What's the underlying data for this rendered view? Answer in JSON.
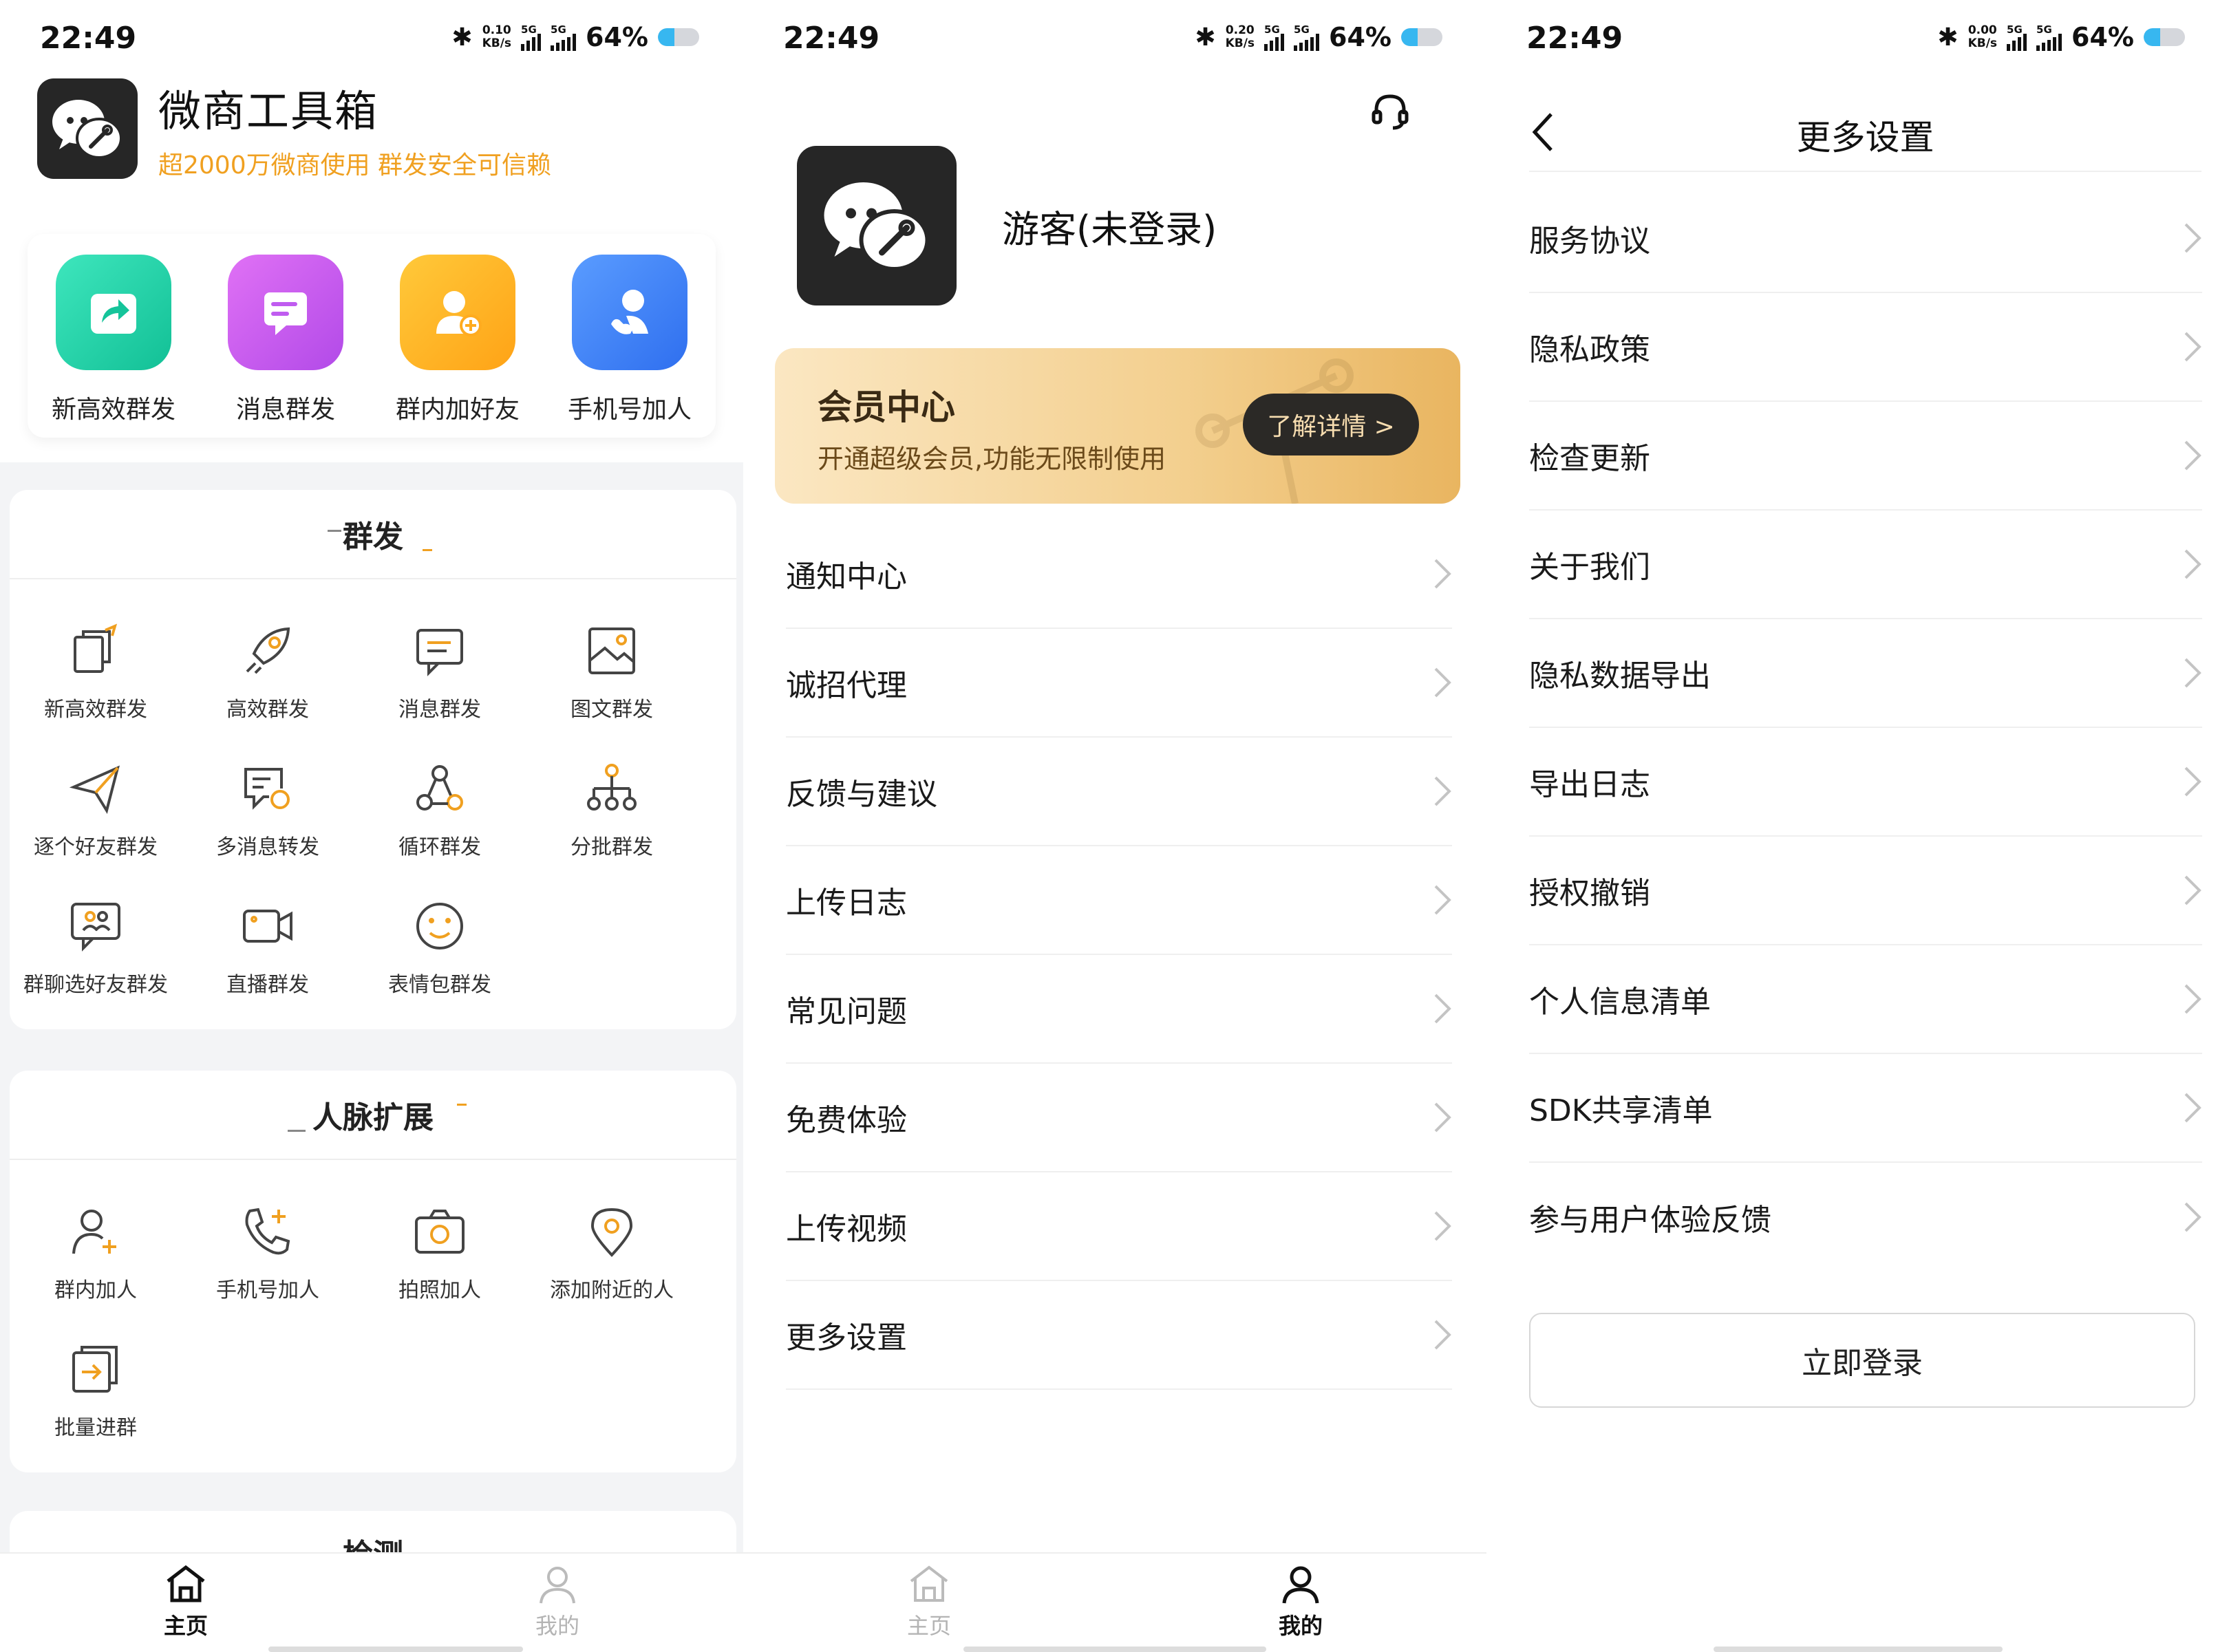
{
  "status_bars": [
    {
      "time": "22:49",
      "speed_top": "0.10",
      "speed_unit": "KB/s",
      "net1": "5G",
      "net2": "5G",
      "battery": "64%"
    },
    {
      "time": "22:49",
      "speed_top": "0.20",
      "speed_unit": "KB/s",
      "net1": "5G",
      "net2": "5G",
      "battery": "64%"
    },
    {
      "time": "22:49",
      "speed_top": "0.00",
      "speed_unit": "KB/s",
      "net1": "5G",
      "net2": "5G",
      "battery": "64%"
    }
  ],
  "home": {
    "app_name": "微商工具箱",
    "slogan": "超2000万微商使用  群发安全可信赖",
    "quick_actions": [
      {
        "label": "新高效群发",
        "icon": "share-icon",
        "color": "#1dcfa6"
      },
      {
        "label": "消息群发",
        "icon": "message-icon",
        "color": "#c85ef0"
      },
      {
        "label": "群内加好友",
        "icon": "add-friend-icon",
        "color": "#ffb21e"
      },
      {
        "label": "手机号加人",
        "icon": "phone-contact-icon",
        "color": "#3d82f6"
      }
    ],
    "section_broadcast": {
      "title": "群发",
      "items": [
        {
          "label": "新高效群发",
          "icon": "copy-share-icon"
        },
        {
          "label": "高效群发",
          "icon": "rocket-icon"
        },
        {
          "label": "消息群发",
          "icon": "message-lines-icon"
        },
        {
          "label": "图文群发",
          "icon": "image-icon"
        },
        {
          "label": "逐个好友群发",
          "icon": "paper-plane-icon"
        },
        {
          "label": "多消息转发",
          "icon": "forward-message-icon"
        },
        {
          "label": "循环群发",
          "icon": "cycle-nodes-icon"
        },
        {
          "label": "分批群发",
          "icon": "hierarchy-icon"
        },
        {
          "label": "群聊选好友群发",
          "icon": "group-chat-icon"
        },
        {
          "label": "直播群发",
          "icon": "video-camera-icon"
        },
        {
          "label": "表情包群发",
          "icon": "smile-icon"
        }
      ]
    },
    "section_network": {
      "title": "人脉扩展",
      "items": [
        {
          "label": "群内加人",
          "icon": "user-plus-icon"
        },
        {
          "label": "手机号加人",
          "icon": "phone-plus-icon"
        },
        {
          "label": "拍照加人",
          "icon": "camera-icon"
        },
        {
          "label": "添加附近的人",
          "icon": "location-pin-icon"
        },
        {
          "label": "批量进群",
          "icon": "batch-enter-icon"
        }
      ]
    },
    "section_detect": {
      "title": "检测"
    }
  },
  "tabs": {
    "home": "主页",
    "mine": "我的"
  },
  "mine": {
    "username": "游客(未登录)",
    "member_title": "会员中心",
    "member_sub": "开通超级会员,功能无限制使用",
    "member_button": "了解详情 >",
    "menu": [
      "通知中心",
      "诚招代理",
      "反馈与建议",
      "上传日志",
      "常见问题",
      "免费体验",
      "上传视频",
      "更多设置"
    ]
  },
  "settings": {
    "title": "更多设置",
    "items": [
      "服务协议",
      "隐私政策",
      "检查更新",
      "关于我们",
      "隐私数据导出",
      "导出日志",
      "授权撤销",
      "个人信息清单",
      "SDK共享清单",
      "参与用户体验反馈"
    ],
    "login_button": "立即登录"
  },
  "colors": {
    "accent_orange": "#f0a020",
    "dark_logo": "#262626"
  }
}
